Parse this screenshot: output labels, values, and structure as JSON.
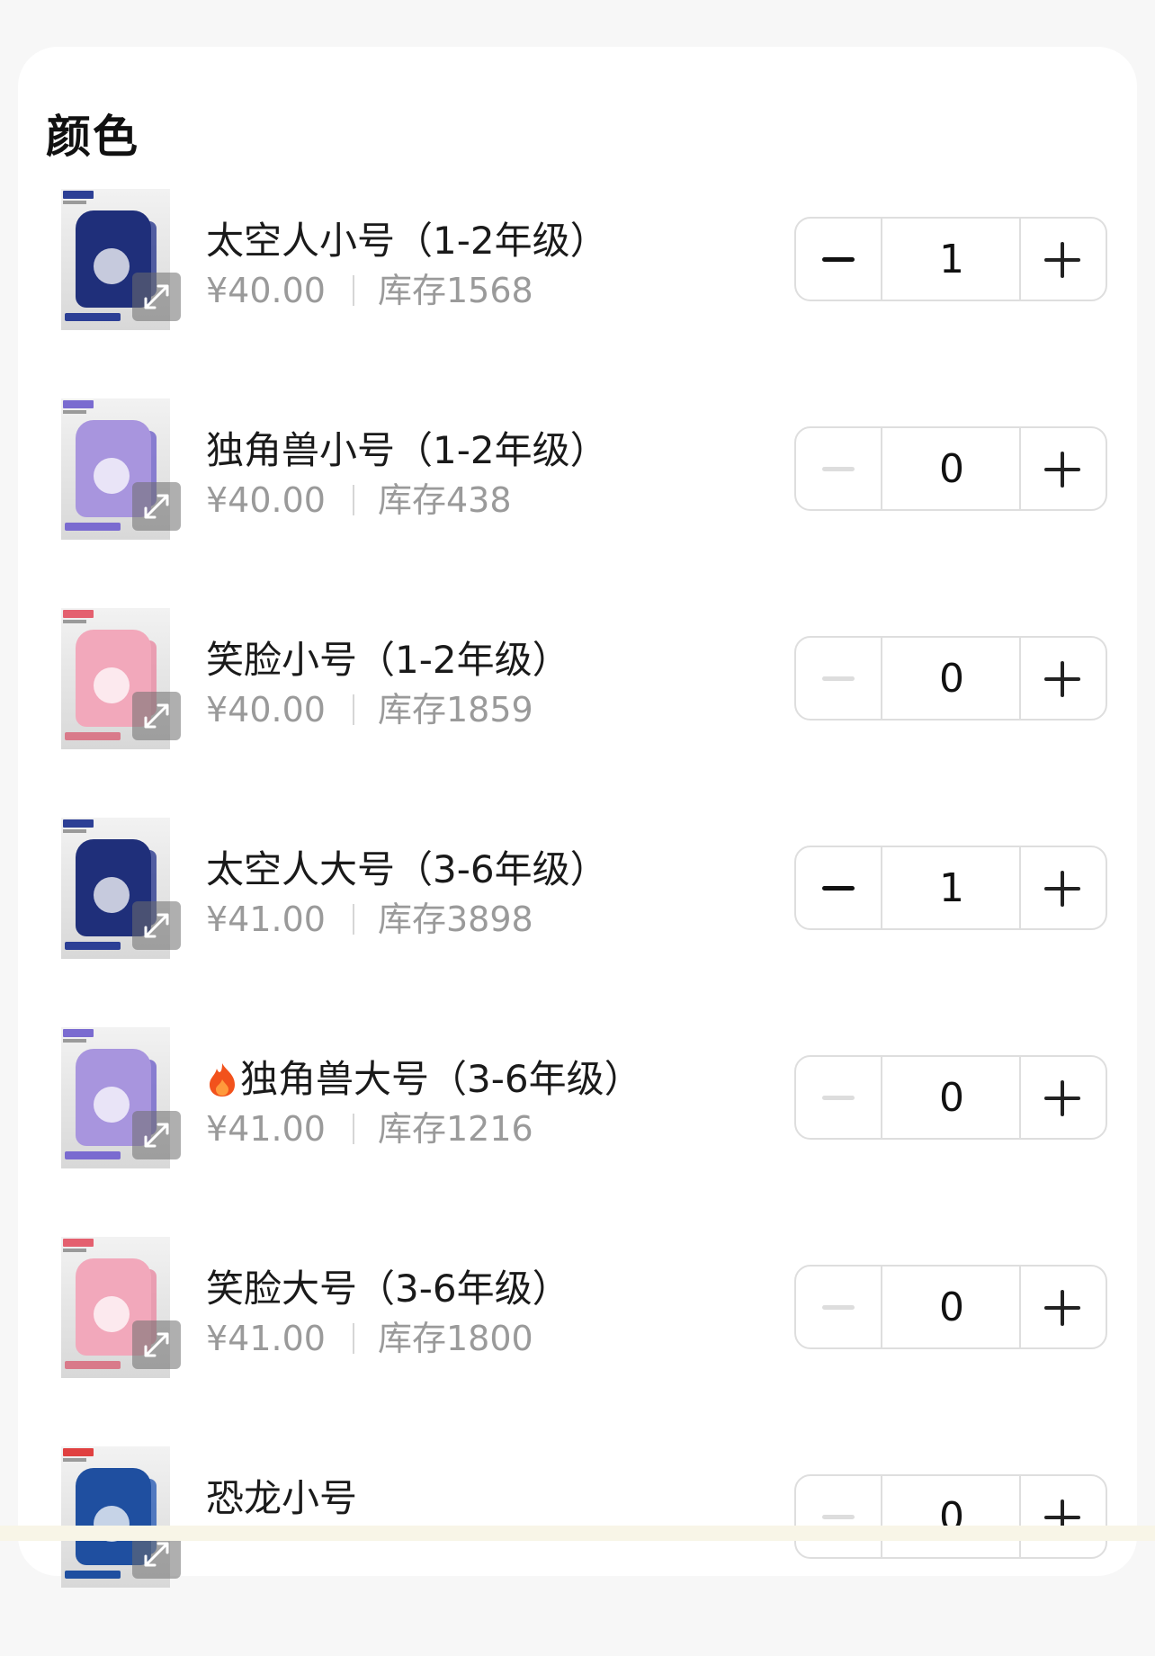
{
  "section": {
    "title": "颜色"
  },
  "items": [
    {
      "name": "太空人小号（1-2年级）",
      "price": "¥40.00",
      "stock": "库存1568",
      "qty": "1",
      "minus_enabled": true,
      "theme": "navy",
      "hot": false
    },
    {
      "name": "独角兽小号（1-2年级）",
      "price": "¥40.00",
      "stock": "库存438",
      "qty": "0",
      "minus_enabled": false,
      "theme": "lavender",
      "hot": false
    },
    {
      "name": "笑脸小号（1-2年级）",
      "price": "¥40.00",
      "stock": "库存1859",
      "qty": "0",
      "minus_enabled": false,
      "theme": "pink",
      "hot": false
    },
    {
      "name": "太空人大号（3-6年级）",
      "price": "¥41.00",
      "stock": "库存3898",
      "qty": "1",
      "minus_enabled": true,
      "theme": "navy",
      "hot": false
    },
    {
      "name": "独角兽大号（3-6年级）",
      "price": "¥41.00",
      "stock": "库存1216",
      "qty": "0",
      "minus_enabled": false,
      "theme": "lavender",
      "hot": true,
      "hot_icon": "fire-icon"
    },
    {
      "name": "笑脸大号（3-6年级）",
      "price": "¥41.00",
      "stock": "库存1800",
      "qty": "0",
      "minus_enabled": false,
      "theme": "pink",
      "hot": false
    },
    {
      "name": "恐龙小号",
      "price": "",
      "stock": "",
      "qty": "0",
      "minus_enabled": false,
      "theme": "blue",
      "hot": false
    }
  ],
  "icons": {
    "expand": "expand-arrows-icon",
    "minus": "minus-icon",
    "plus": "plus-icon"
  },
  "themes": {
    "navy": {
      "bag": "#1f2f7a",
      "strap": "#2a3a8e",
      "tag": "#2c3f95",
      "strip": "#2c3f95"
    },
    "lavender": {
      "bag": "#a895de",
      "strap": "#6f62c9",
      "tag": "#7a6bd0",
      "strip": "#7a6bd0"
    },
    "pink": {
      "bag": "#f2a8bb",
      "strap": "#e98aa2",
      "tag": "#e4606f",
      "strip": "#d97a8a"
    },
    "blue": {
      "bag": "#1f4fa0",
      "strap": "#2a5db5",
      "tag": "#e04040",
      "strip": "#1f4fa0"
    }
  }
}
